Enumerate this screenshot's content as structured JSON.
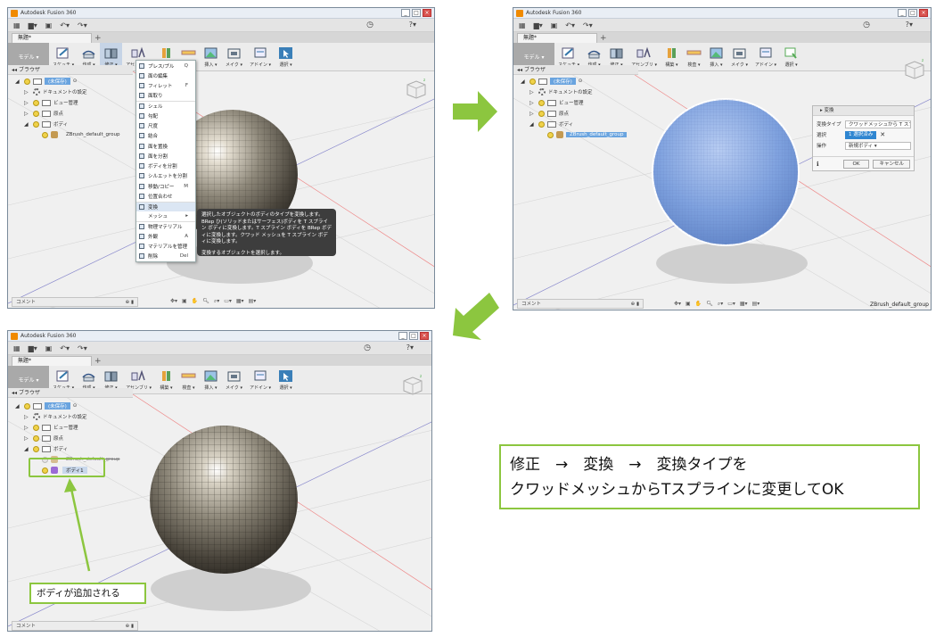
{
  "app": {
    "title": "Autodesk Fusion 360",
    "doc_tab": "無題*",
    "workspace": "モデル ▾",
    "toolbar_groups": [
      {
        "label": "スケッチ ▾",
        "icon": "sketch-icon"
      },
      {
        "label": "作成 ▾",
        "icon": "create-icon"
      },
      {
        "label": "修正 ▾",
        "icon": "modify-icon"
      },
      {
        "label": "アセンブリ ▾",
        "icon": "assemble-icon"
      },
      {
        "label": "構築 ▾",
        "icon": "construct-icon"
      },
      {
        "label": "検査 ▾",
        "icon": "inspect-icon"
      },
      {
        "label": "挿入 ▾",
        "icon": "insert-icon"
      },
      {
        "label": "メイク ▾",
        "icon": "make-icon"
      },
      {
        "label": "アドイン ▾",
        "icon": "addins-icon"
      },
      {
        "label": "選択 ▾",
        "icon": "select-icon"
      }
    ],
    "browser_label": "ブラウザ",
    "comment_label": "コメント",
    "tree": {
      "root": "(未保存)",
      "doc_settings": "ドキュメントの設定",
      "named_views": "ビュー管理",
      "origin": "原点",
      "bodies": "ボディ",
      "group": "ZBrush_default_group",
      "new_body": "ボディ1"
    },
    "status_group": "ZBrush_default_group"
  },
  "modify_menu": [
    {
      "label": "プレス/プル",
      "shortcut": "Q"
    },
    {
      "label": "面の編集",
      "shortcut": ""
    },
    {
      "label": "フィレット",
      "shortcut": "F"
    },
    {
      "label": "面取り",
      "shortcut": ""
    },
    {
      "label": "シェル",
      "shortcut": ""
    },
    {
      "label": "勾配",
      "shortcut": ""
    },
    {
      "label": "尺度",
      "shortcut": ""
    },
    {
      "label": "結合",
      "shortcut": ""
    },
    {
      "label": "面を置換",
      "shortcut": ""
    },
    {
      "label": "面を分割",
      "shortcut": ""
    },
    {
      "label": "ボディを分割",
      "shortcut": ""
    },
    {
      "label": "シルエットを分割",
      "shortcut": ""
    },
    {
      "label": "移動/コピー",
      "shortcut": "M"
    },
    {
      "label": "位置合わせ",
      "shortcut": ""
    },
    {
      "label": "変換",
      "shortcut": ""
    },
    {
      "label": "メッシュ",
      "shortcut": "▸"
    },
    {
      "label": "物理マテリアル",
      "shortcut": ""
    },
    {
      "label": "外観",
      "shortcut": "A"
    },
    {
      "label": "マテリアルを管理",
      "shortcut": ""
    },
    {
      "label": "削除",
      "shortcut": "Del"
    }
  ],
  "tooltip": {
    "line1": "選択したオブジェクトのボディのタイプを変換します。BRep ひ(ソリッドまたはサーフェス)ボディを T スプライン ボディに変換します。T スプライン ボディを BRep ボディに変換します。クワッド メッシュを T スプライン ボディに変換します。",
    "line2": "変換するオブジェクトを選択します。"
  },
  "convert_dialog": {
    "title": "変換",
    "type_label": "変換タイプ",
    "type_value": "クワッドメッシュから T スプラ... ▾",
    "select_label": "選択",
    "select_value": "1 選択済み",
    "operation_label": "操作",
    "operation_value": "新規ボディ ▾",
    "ok": "OK",
    "cancel": "キャンセル"
  },
  "callout": {
    "line1": "修正　→　変換　→　変換タイプを",
    "line2": "クワッドメッシュからTスプラインに変更してOK"
  },
  "annotation_label": "ボディが追加される",
  "colors": {
    "accent": "#8cc63f",
    "highlight": "#6aa4df",
    "sphere_blue": "#7aa0dd"
  }
}
